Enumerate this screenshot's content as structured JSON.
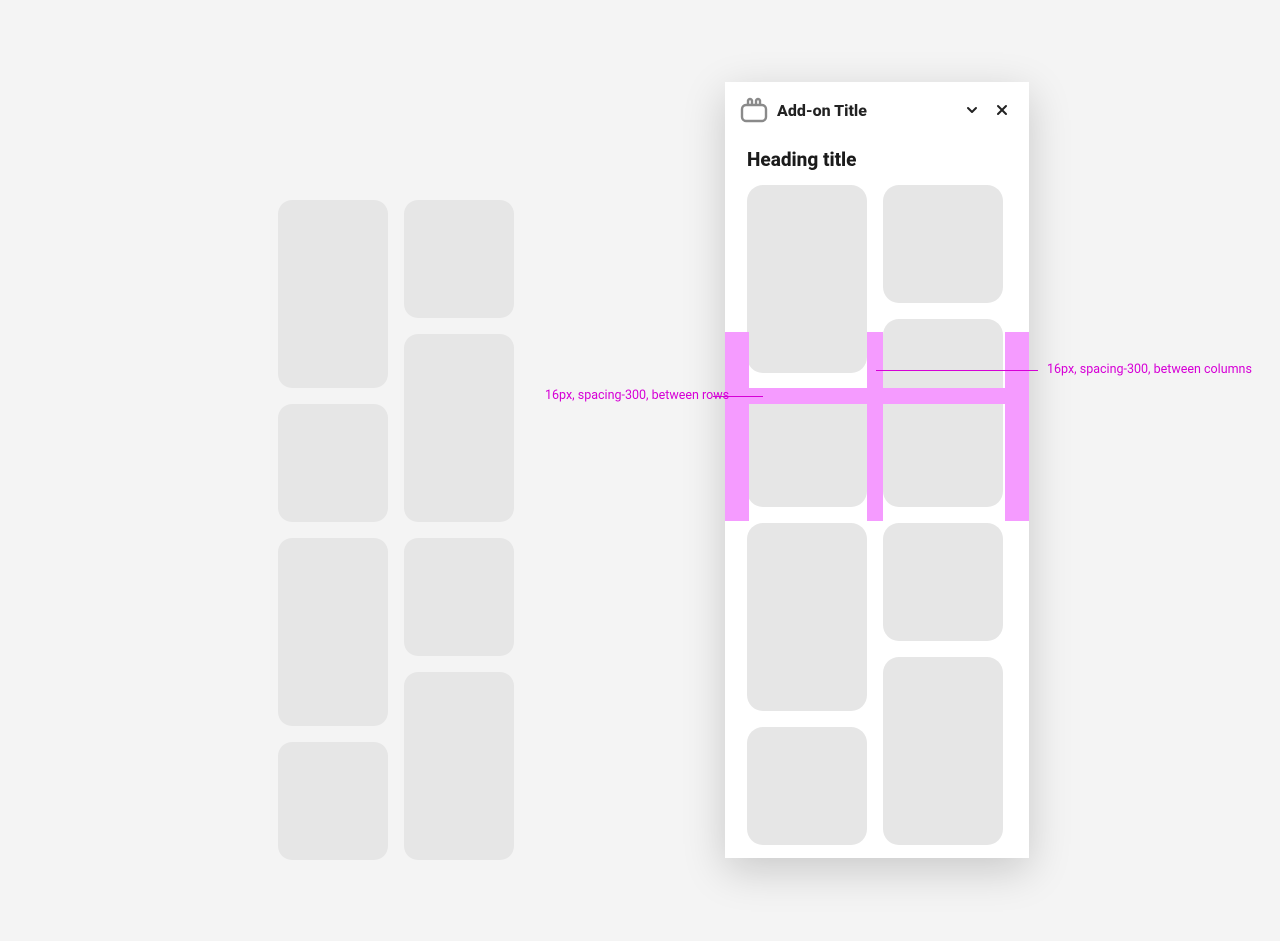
{
  "panel": {
    "title": "Add-on Title",
    "heading": "Heading title"
  },
  "annotations": {
    "rows": "16px, spacing-300, between rows",
    "cols": "16px, spacing-300, between columns"
  },
  "left_heights": {
    "c1": [
      188,
      118,
      188,
      118
    ],
    "c2": [
      118,
      188,
      118,
      188
    ]
  },
  "right_heights": {
    "c1": [
      188,
      118,
      188,
      118
    ],
    "c2": [
      118,
      188,
      118,
      188
    ]
  }
}
